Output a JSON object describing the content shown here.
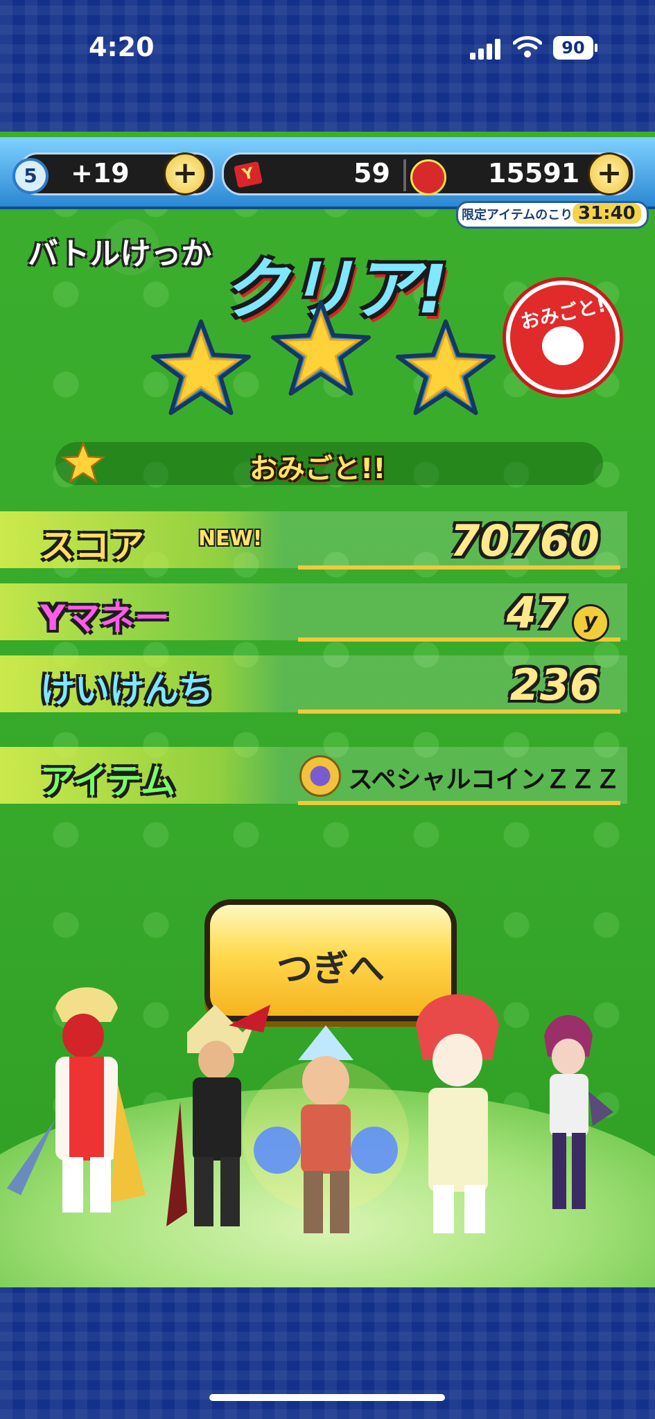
{
  "status_bar": {
    "time": "4:20",
    "battery": "90"
  },
  "currency": {
    "stamina_level": "5",
    "stamina_bonus": "+19",
    "y_tickets": "59",
    "y_money": "15591",
    "plus": "+"
  },
  "limited_item": {
    "label": "限定アイテムのこり",
    "time": "31:40"
  },
  "result": {
    "header": "バトルけっか",
    "title": "クリア!",
    "stars": 3,
    "medal_text": "おみごと!",
    "banner_text": "おみごと!!"
  },
  "rows": [
    {
      "label": "スコア",
      "value": "70760",
      "badge": "NEW!",
      "color": "#ffe15a"
    },
    {
      "label": "Yマネー",
      "value": "47",
      "unit": "y",
      "color": "#ff5de7"
    },
    {
      "label": "けいけんち",
      "value": "236",
      "color": "#7ee8ff"
    }
  ],
  "item": {
    "label": "アイテム",
    "name": "スペシャルコインＺＺＺ",
    "color": "#7bff62"
  },
  "next_button": {
    "label": "つぎへ"
  },
  "colors": {
    "frame": "#13318a",
    "field": "#36a82a",
    "button": "#ffd94d"
  }
}
